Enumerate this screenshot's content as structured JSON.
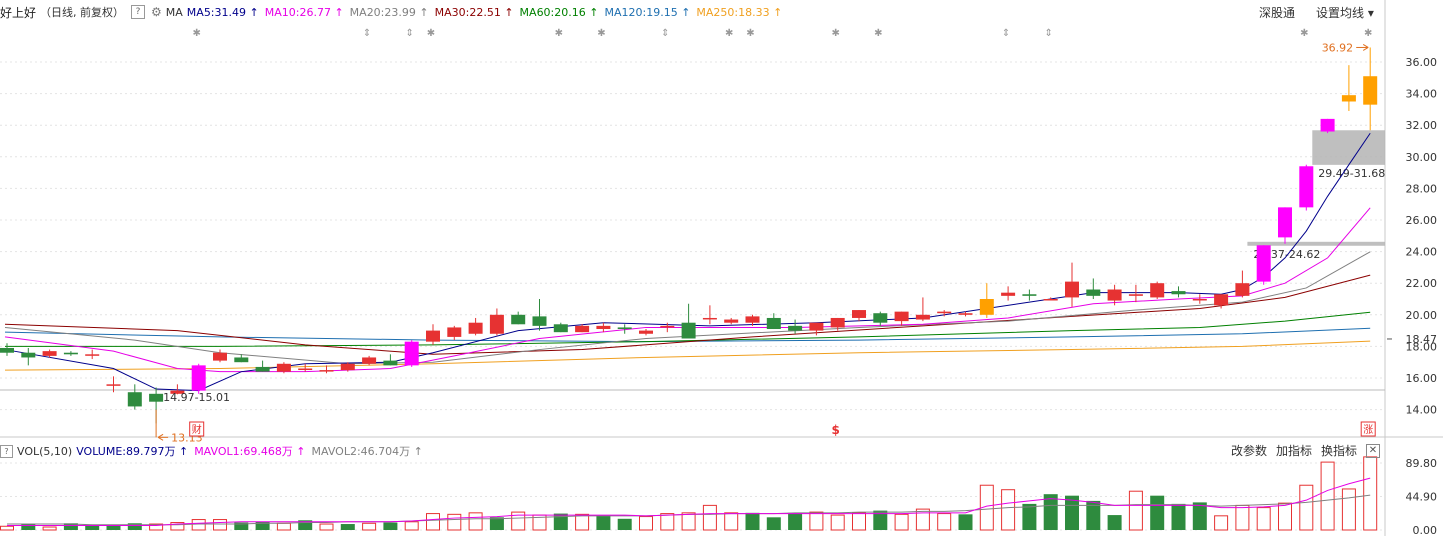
{
  "header": {
    "stock_name": "好上好",
    "period": "（日线, 前复权）",
    "help": "?",
    "ma_label": "MA",
    "ma_items": [
      {
        "text": "MA5:31.49",
        "arrow": "↑",
        "color": "#00008b"
      },
      {
        "text": "MA10:26.77",
        "arrow": "↑",
        "color": "#e600e6"
      },
      {
        "text": "MA20:23.99",
        "arrow": "↑",
        "color": "#808080"
      },
      {
        "text": "MA30:22.51",
        "arrow": "↑",
        "color": "#8b0000"
      },
      {
        "text": "MA60:20.16",
        "arrow": "↑",
        "color": "#008000"
      },
      {
        "text": "MA120:19.15",
        "arrow": "↑",
        "color": "#1e6fb0"
      },
      {
        "text": "MA250:18.33",
        "arrow": "↑",
        "color": "#f0a020"
      }
    ],
    "btn_market": "深股通",
    "btn_setting": "设置均线 ▾"
  },
  "volume_header": {
    "box": "?",
    "label": "VOL(5,10)",
    "items": [
      {
        "text": "VOLUME:89.797万",
        "arrow": "↑",
        "color": "#00008b"
      },
      {
        "text": "MAVOL1:69.468万",
        "arrow": "↑",
        "color": "#e600e6"
      },
      {
        "text": "MAVOL2:46.704万",
        "arrow": "↑",
        "color": "#808080"
      }
    ],
    "btn_params": "改参数",
    "btn_add": "加指标",
    "btn_switch": "换指标",
    "btn_close": "✕"
  },
  "chart_data": {
    "type": "candlestick",
    "y_ticks": [
      "14.00",
      "16.00",
      "18.00",
      "20.00",
      "22.00",
      "24.00",
      "26.00",
      "28.00",
      "30.00",
      "32.00",
      "34.00",
      "36.00"
    ],
    "current_price": "18.47",
    "vol_ticks": [
      "0.00",
      "44.90",
      "89.80"
    ],
    "candles": [
      [
        17.9,
        18.2,
        17.4,
        17.6
      ],
      [
        17.6,
        17.9,
        16.8,
        17.3
      ],
      [
        17.4,
        17.8,
        17.3,
        17.7
      ],
      [
        17.6,
        17.7,
        17.4,
        17.5
      ],
      [
        17.5,
        17.8,
        17.2,
        17.5
      ],
      [
        15.6,
        16.1,
        15.1,
        15.6
      ],
      [
        15.1,
        15.6,
        14.0,
        14.2
      ],
      [
        15.0,
        15.4,
        13.13,
        14.5
      ],
      [
        15.0,
        15.6,
        14.97,
        15.2
      ],
      [
        15.2,
        16.9,
        15.0,
        16.8
      ],
      [
        17.1,
        17.8,
        17.0,
        17.6
      ],
      [
        17.3,
        17.5,
        17.0,
        17.0
      ],
      [
        16.7,
        17.1,
        16.4,
        16.4
      ],
      [
        16.4,
        17.0,
        16.3,
        16.9
      ],
      [
        16.6,
        16.9,
        16.4,
        16.6
      ],
      [
        16.5,
        16.8,
        16.3,
        16.5
      ],
      [
        16.5,
        17.0,
        16.4,
        16.9
      ],
      [
        16.9,
        17.4,
        16.8,
        17.3
      ],
      [
        17.1,
        17.5,
        16.8,
        16.8
      ],
      [
        16.8,
        18.4,
        16.7,
        18.3
      ],
      [
        18.3,
        19.4,
        18.1,
        19.0
      ],
      [
        18.6,
        19.3,
        18.4,
        19.2
      ],
      [
        18.8,
        19.8,
        18.7,
        19.5
      ],
      [
        18.8,
        20.4,
        18.7,
        20.0
      ],
      [
        20.0,
        20.2,
        19.4,
        19.4
      ],
      [
        19.9,
        21.0,
        19.0,
        19.3
      ],
      [
        19.4,
        19.5,
        18.9,
        18.9
      ],
      [
        18.9,
        19.4,
        18.9,
        19.3
      ],
      [
        19.1,
        19.5,
        18.9,
        19.3
      ],
      [
        19.2,
        19.4,
        18.8,
        19.1
      ],
      [
        18.8,
        19.1,
        18.7,
        19.0
      ],
      [
        19.2,
        19.5,
        18.9,
        19.3
      ],
      [
        19.5,
        20.7,
        18.5,
        18.5
      ],
      [
        19.8,
        20.6,
        19.4,
        19.8
      ],
      [
        19.5,
        19.8,
        19.4,
        19.7
      ],
      [
        19.5,
        20.0,
        19.3,
        19.9
      ],
      [
        19.8,
        20.1,
        19.1,
        19.1
      ],
      [
        19.3,
        19.7,
        18.8,
        19.0
      ],
      [
        19.0,
        19.4,
        18.7,
        19.5
      ],
      [
        19.2,
        19.8,
        19.0,
        19.8
      ],
      [
        19.8,
        20.3,
        19.6,
        20.3
      ],
      [
        20.1,
        20.2,
        19.3,
        19.5
      ],
      [
        19.6,
        20.2,
        19.3,
        20.2
      ],
      [
        19.7,
        21.1,
        19.6,
        20.0
      ],
      [
        20.1,
        20.3,
        19.9,
        20.2
      ],
      [
        20.0,
        20.2,
        19.9,
        20.1
      ],
      [
        20.0,
        22.0,
        19.8,
        21.0
      ],
      [
        21.2,
        21.8,
        20.9,
        21.4
      ],
      [
        21.3,
        21.6,
        20.9,
        21.2
      ],
      [
        21.0,
        21.1,
        21.0,
        21.0
      ],
      [
        21.1,
        23.3,
        20.5,
        22.1
      ],
      [
        21.6,
        22.3,
        21.0,
        21.2
      ],
      [
        20.9,
        21.9,
        20.6,
        21.6
      ],
      [
        21.2,
        21.9,
        20.8,
        21.3
      ],
      [
        21.1,
        22.1,
        21.0,
        22.0
      ],
      [
        21.5,
        21.8,
        21.1,
        21.3
      ],
      [
        21.0,
        21.3,
        20.7,
        21.0
      ],
      [
        20.6,
        21.1,
        20.4,
        21.3
      ],
      [
        21.2,
        22.8,
        21.1,
        22.0
      ],
      [
        22.1,
        24.4,
        21.9,
        24.4
      ],
      [
        24.9,
        26.8,
        24.5,
        26.8
      ],
      [
        26.8,
        29.5,
        26.6,
        29.4
      ],
      [
        31.6,
        32.4,
        31.5,
        32.4
      ],
      [
        33.5,
        35.8,
        32.9,
        33.9
      ],
      [
        33.3,
        36.92,
        31.68,
        35.1
      ]
    ],
    "volumes": [
      5,
      8,
      4,
      9,
      6,
      7,
      9,
      8,
      10,
      14,
      14,
      10,
      11,
      9,
      13,
      8,
      8,
      9,
      10,
      11,
      22,
      21,
      23,
      17,
      24,
      20,
      22,
      21,
      20,
      15,
      18,
      22,
      23,
      33,
      23,
      23,
      17,
      23,
      24,
      20,
      23,
      26,
      21,
      28,
      22,
      21,
      60,
      54,
      35,
      48,
      46,
      39,
      20,
      52,
      46,
      35,
      37,
      19,
      33,
      30,
      36,
      60,
      91,
      55,
      98
    ],
    "vol_colors": [
      "r",
      "g",
      "r",
      "g",
      "g",
      "g",
      "g",
      "r",
      "r",
      "r",
      "r",
      "g",
      "g",
      "r",
      "g",
      "r",
      "g",
      "r",
      "g",
      "r",
      "r",
      "r",
      "r",
      "g",
      "r",
      "r",
      "g",
      "r",
      "g",
      "g",
      "r",
      "r",
      "r",
      "r",
      "r",
      "g",
      "g",
      "g",
      "r",
      "r",
      "r",
      "g",
      "r",
      "r",
      "r",
      "g",
      "r",
      "r",
      "g",
      "g",
      "g",
      "g",
      "g",
      "r",
      "g",
      "g",
      "g",
      "r",
      "r",
      "r",
      "r",
      "r",
      "r",
      "r",
      "r"
    ],
    "ma_lines": {
      "ma5": [
        [
          0,
          17.8
        ],
        [
          5,
          16.6
        ],
        [
          7,
          15.3
        ],
        [
          9,
          15.2
        ],
        [
          11,
          16.4
        ],
        [
          14,
          16.9
        ],
        [
          18,
          17.0
        ],
        [
          20,
          17.6
        ],
        [
          24,
          19.0
        ],
        [
          28,
          19.5
        ],
        [
          33,
          19.3
        ],
        [
          38,
          19.5
        ],
        [
          43,
          19.8
        ],
        [
          48,
          20.8
        ],
        [
          51,
          21.4
        ],
        [
          55,
          21.4
        ],
        [
          57,
          21.3
        ],
        [
          58,
          21.6
        ],
        [
          59,
          22.4
        ],
        [
          60,
          23.6
        ],
        [
          61,
          25.3
        ],
        [
          62,
          27.5
        ],
        [
          63,
          29.5
        ],
        [
          64,
          31.49
        ]
      ],
      "ma10": [
        [
          0,
          18.6
        ],
        [
          5,
          17.7
        ],
        [
          8,
          16.6
        ],
        [
          10,
          16.4
        ],
        [
          14,
          16.4
        ],
        [
          18,
          16.6
        ],
        [
          21,
          17.4
        ],
        [
          25,
          18.5
        ],
        [
          30,
          19.2
        ],
        [
          37,
          19.2
        ],
        [
          43,
          19.4
        ],
        [
          47,
          19.8
        ],
        [
          51,
          20.7
        ],
        [
          55,
          21.0
        ],
        [
          58,
          21.2
        ],
        [
          60,
          22.0
        ],
        [
          62,
          23.6
        ],
        [
          64,
          26.77
        ]
      ],
      "ma20": [
        [
          0,
          19.2
        ],
        [
          6,
          18.4
        ],
        [
          10,
          17.6
        ],
        [
          16,
          16.9
        ],
        [
          20,
          17.0
        ],
        [
          25,
          17.8
        ],
        [
          30,
          18.5
        ],
        [
          40,
          19.2
        ],
        [
          47,
          19.6
        ],
        [
          53,
          20.3
        ],
        [
          58,
          20.8
        ],
        [
          61,
          21.7
        ],
        [
          64,
          23.99
        ]
      ],
      "ma30": [
        [
          0,
          19.4
        ],
        [
          8,
          19.0
        ],
        [
          14,
          18.1
        ],
        [
          20,
          17.5
        ],
        [
          27,
          17.8
        ],
        [
          35,
          18.6
        ],
        [
          43,
          19.3
        ],
        [
          50,
          19.9
        ],
        [
          56,
          20.4
        ],
        [
          60,
          21.1
        ],
        [
          64,
          22.51
        ]
      ],
      "ma60": [
        [
          0,
          18.0
        ],
        [
          10,
          18.0
        ],
        [
          20,
          18.1
        ],
        [
          30,
          18.3
        ],
        [
          40,
          18.6
        ],
        [
          50,
          19.0
        ],
        [
          56,
          19.2
        ],
        [
          60,
          19.6
        ],
        [
          64,
          20.16
        ]
      ],
      "ma120": [
        [
          0,
          18.9
        ],
        [
          10,
          18.6
        ],
        [
          20,
          18.4
        ],
        [
          30,
          18.3
        ],
        [
          40,
          18.4
        ],
        [
          50,
          18.6
        ],
        [
          58,
          18.8
        ],
        [
          64,
          19.15
        ]
      ],
      "ma250": [
        [
          0,
          16.5
        ],
        [
          10,
          16.6
        ],
        [
          20,
          16.9
        ],
        [
          30,
          17.3
        ],
        [
          40,
          17.6
        ],
        [
          50,
          17.8
        ],
        [
          58,
          18.0
        ],
        [
          64,
          18.33
        ]
      ]
    },
    "mavol1": [
      6,
      6,
      6,
      6,
      6,
      6,
      6,
      6,
      8,
      9,
      10,
      11,
      11,
      11,
      11,
      11,
      11,
      11,
      11,
      12,
      14,
      16,
      17,
      18,
      20,
      20,
      20,
      20,
      20,
      20,
      19,
      20,
      21,
      22,
      22,
      22,
      22,
      22,
      22,
      22,
      22,
      22,
      22,
      23,
      23,
      23,
      32,
      36,
      39,
      42,
      40,
      37,
      33,
      33,
      33,
      33,
      33,
      30,
      30,
      31,
      33,
      40,
      53,
      62,
      69.468
    ],
    "mavol2": [
      8,
      8,
      8,
      8,
      7,
      7,
      7,
      7,
      7,
      8,
      8,
      8,
      9,
      9,
      10,
      10,
      11,
      11,
      11,
      12,
      13,
      14,
      15,
      15,
      16,
      17,
      18,
      19,
      19,
      19,
      19,
      20,
      21,
      21,
      22,
      22,
      22,
      23,
      23,
      23,
      24,
      24,
      24,
      25,
      25,
      26,
      28,
      30,
      31,
      33,
      33,
      33,
      33,
      34,
      34,
      34,
      33,
      32,
      33,
      34,
      35,
      37,
      40,
      43,
      46.704
    ],
    "price_zones": [
      {
        "low": 29.49,
        "high": 31.68,
        "label": "29.49-31.68"
      },
      {
        "low": 24.37,
        "high": 24.62,
        "label": "24.37-24.62"
      }
    ],
    "annotations": {
      "high_label": "36.92",
      "low_label": "13.13",
      "gap_label": "14.97-15.01"
    },
    "markers": [
      {
        "idx": 9,
        "text": "财"
      },
      {
        "idx": 39,
        "text": "$"
      },
      {
        "idx": 64,
        "text": "涨"
      }
    ],
    "top_symbols": [
      {
        "idx": 9,
        "sym": "✱"
      },
      {
        "idx": 17,
        "sym": "⇕"
      },
      {
        "idx": 19,
        "sym": "⇕"
      },
      {
        "idx": 20,
        "sym": "✱"
      },
      {
        "idx": 26,
        "sym": "✱"
      },
      {
        "idx": 28,
        "sym": "✱"
      },
      {
        "idx": 31,
        "sym": "⇕"
      },
      {
        "idx": 34,
        "sym": "✱"
      },
      {
        "idx": 35,
        "sym": "✱"
      },
      {
        "idx": 39,
        "sym": "✱"
      },
      {
        "idx": 41,
        "sym": "✱"
      },
      {
        "idx": 47,
        "sym": "⇕"
      },
      {
        "idx": 49,
        "sym": "⇕"
      },
      {
        "idx": 61,
        "sym": "✱"
      },
      {
        "idx": 64,
        "sym": "✱"
      }
    ],
    "colors": {
      "up": "#e63232",
      "down": "#2e8b3e",
      "limit_up": "#ff00ff",
      "special": "#ffa000",
      "grid": "#e4e4e4",
      "zone": "#b4b4b4",
      "annot": "#e07020"
    }
  }
}
